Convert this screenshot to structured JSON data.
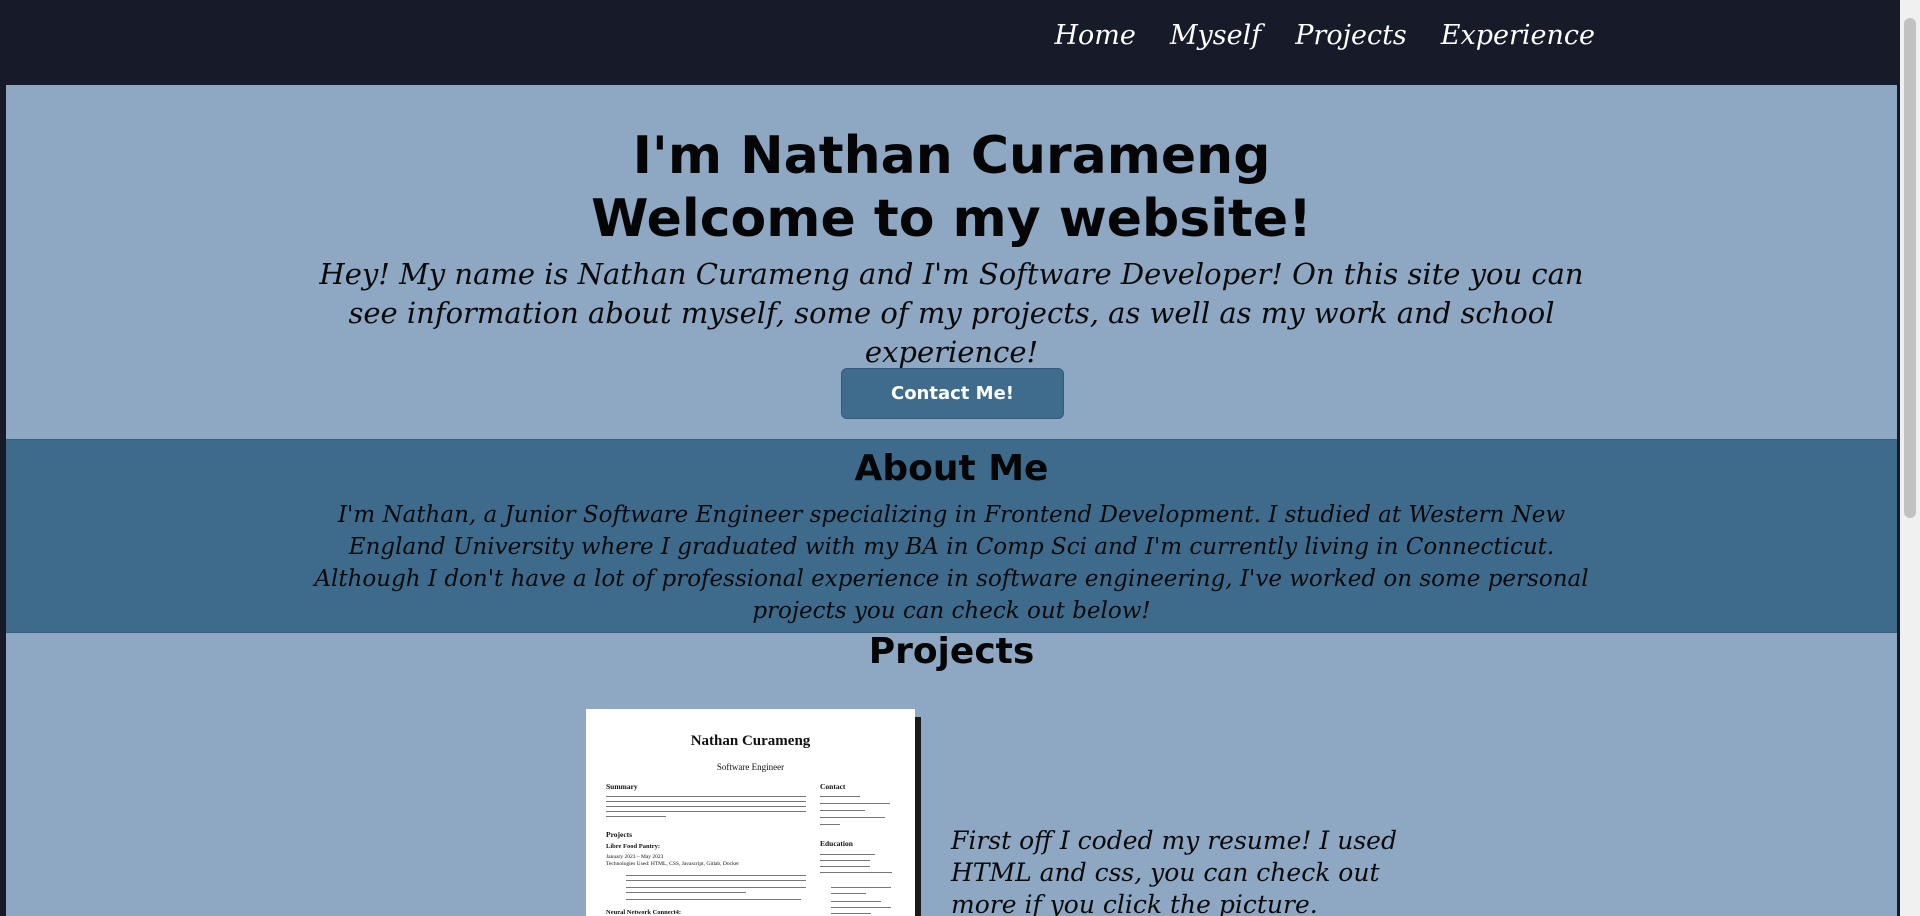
{
  "nav": {
    "items": [
      {
        "label": "Home"
      },
      {
        "label": "Myself"
      },
      {
        "label": "Projects"
      },
      {
        "label": "Experience"
      }
    ]
  },
  "hero": {
    "title_line1": "I'm Nathan Curameng",
    "title_line2": "Welcome to my website!",
    "intro": "Hey! My name is Nathan Curameng and I'm Software Developer! On this site you can see information about myself, some of my projects, as well as my work and school experience!",
    "button_label": "Contact Me!"
  },
  "about": {
    "title": "About Me",
    "text": "I'm Nathan, a Junior Software Engineer specializing in Frontend Development. I studied at Western New England University where I graduated with my BA in Comp Sci and I'm currently living in Connecticut. Although I don't have a lot of professional experience in software engineering, I've worked on some personal projects you can check out below!"
  },
  "projects": {
    "title": "Projects",
    "resume": {
      "name": "Nathan Curameng",
      "role": "Software Engineer",
      "summary_heading": "Summary",
      "projects_heading": "Projects",
      "project1_title": "Libre Food Pantry:",
      "project1_date": "January 2023 – May 2023",
      "project1_tech": "Technologies Used: HTML, CSS, Javascript, Gitlab, Docker",
      "project2_title": "Neural Network Connect4:",
      "contact_heading": "Contact",
      "education_heading": "Education"
    },
    "description": "First off I coded my resume! I used HTML and css, you can check out more if you click the picture."
  }
}
